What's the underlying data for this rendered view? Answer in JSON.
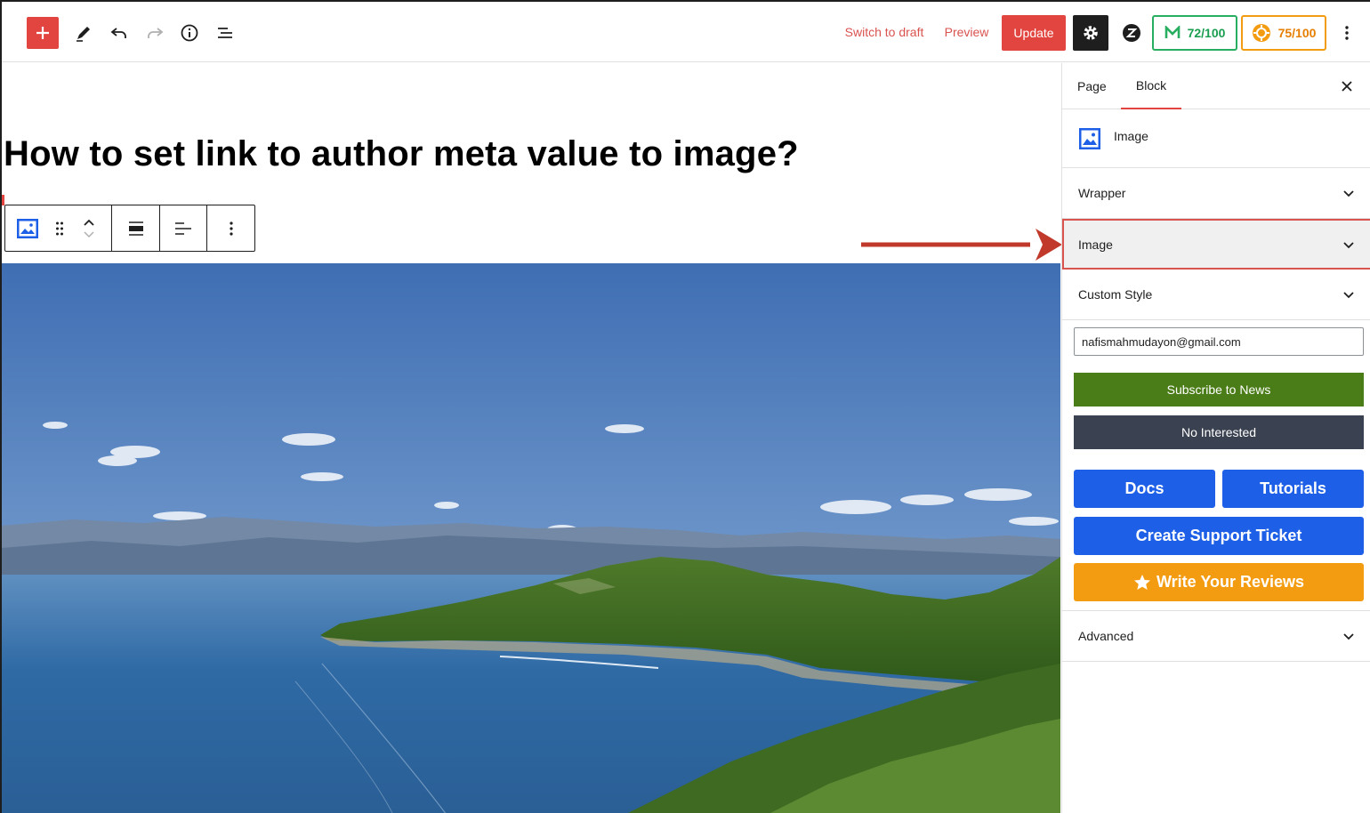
{
  "topbar": {
    "switch_draft": "Switch to draft",
    "preview": "Preview",
    "update": "Update",
    "score_green": "72/100",
    "score_orange": "75/100"
  },
  "post": {
    "title": "How to set link to author meta value to image?"
  },
  "sidebar": {
    "tabs": [
      "Page",
      "Block"
    ],
    "active_tab": "Block",
    "block_name": "Image",
    "panels": {
      "wrapper": "Wrapper",
      "image": "Image",
      "custom_style": "Custom Style",
      "advanced": "Advanced"
    },
    "promo": {
      "email_value": "nafismahmudayon@gmail.com",
      "subscribe": "Subscribe to News",
      "not_interested": "No Interested",
      "docs": "Docs",
      "tutorials": "Tutorials",
      "support": "Create Support Ticket",
      "reviews": "Write Your Reviews"
    }
  },
  "colors": {
    "accent_red": "#e2453f",
    "score_green": "#27ae60",
    "score_orange": "#f39c12",
    "blue": "#1d5fe6",
    "subscribe_green": "#4a7c17",
    "dark_btn": "#3a4150"
  }
}
